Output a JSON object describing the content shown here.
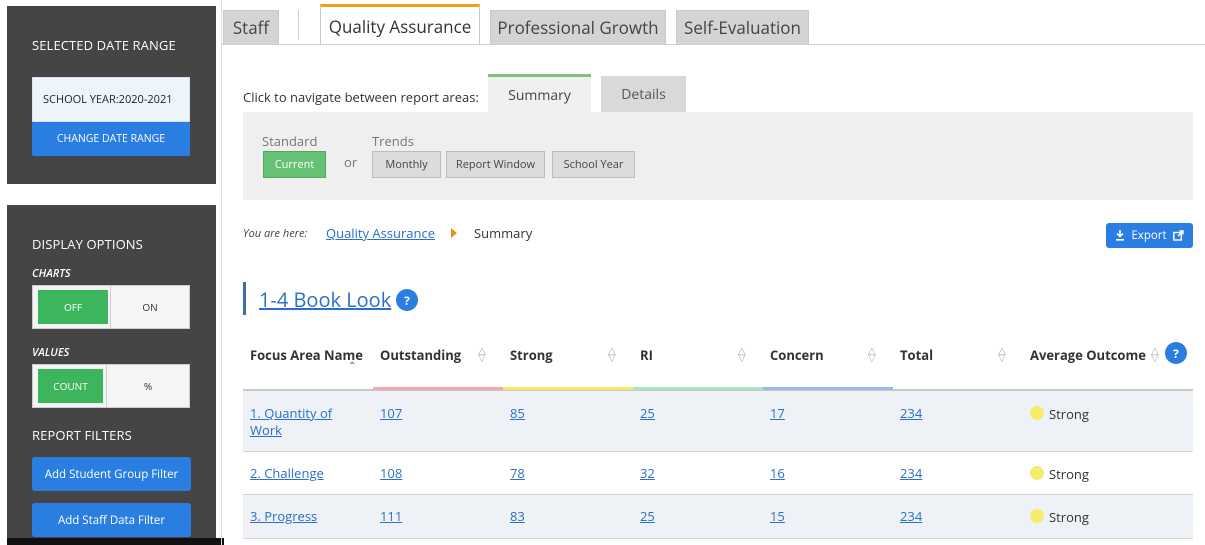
{
  "sidebar": {
    "date_range_title": "SELECTED DATE RANGE",
    "date_range_value": "SCHOOL YEAR:2020-2021",
    "change_date_label": "CHANGE DATE RANGE",
    "display_options_title": "DISPLAY OPTIONS",
    "charts_label": "CHARTS",
    "charts_off": "OFF",
    "charts_on": "ON",
    "values_label": "VALUES",
    "values_count": "COUNT",
    "values_percent": "%",
    "report_filters_title": "REPORT FILTERS",
    "add_student_group_filter": "Add Student Group Filter",
    "add_staff_data_filter": "Add Staff Data Filter"
  },
  "top_tabs": [
    "Staff",
    "Quality Assurance",
    "Professional Growth",
    "Self-Evaluation"
  ],
  "report_nav": {
    "label": "Click to navigate between report areas:",
    "tabs": [
      "Summary",
      "Details"
    ]
  },
  "filters": {
    "standard_label": "Standard",
    "current": "Current",
    "or": "or",
    "trends_label": "Trends",
    "monthly": "Monthly",
    "report_window": "Report Window",
    "school_year": "School Year"
  },
  "breadcrumb": {
    "prefix": "You are here:",
    "link": "Quality Assurance",
    "current": "Summary"
  },
  "export_label": "Export",
  "colors": {
    "accent_blue": "#2a7de1",
    "toggle_green": "#3cb55c",
    "active_tab_orange": "#f0a020",
    "outstanding_bar": "#f4a7b9",
    "strong_bar": "#f5ec6b",
    "ri_bar": "#a8e6c4",
    "concern_bar": "#9fb8e8",
    "total_bar": "#c8c8c8"
  },
  "section": {
    "title": "1-4 Book Look",
    "help": "?"
  },
  "table": {
    "headers": [
      "Focus Area Name",
      "Outstanding",
      "Strong",
      "RI",
      "Concern",
      "Total",
      "Average Outcome"
    ],
    "rows": [
      {
        "name": "1. Quantity of Work",
        "outstanding": "107",
        "strong": "85",
        "ri": "25",
        "concern": "17",
        "total": "234",
        "outcome": "Strong"
      },
      {
        "name": "2. Challenge",
        "outstanding": "108",
        "strong": "78",
        "ri": "32",
        "concern": "16",
        "total": "234",
        "outcome": "Strong"
      },
      {
        "name": "3. Progress",
        "outstanding": "111",
        "strong": "83",
        "ri": "25",
        "concern": "15",
        "total": "234",
        "outcome": "Strong"
      }
    ]
  }
}
